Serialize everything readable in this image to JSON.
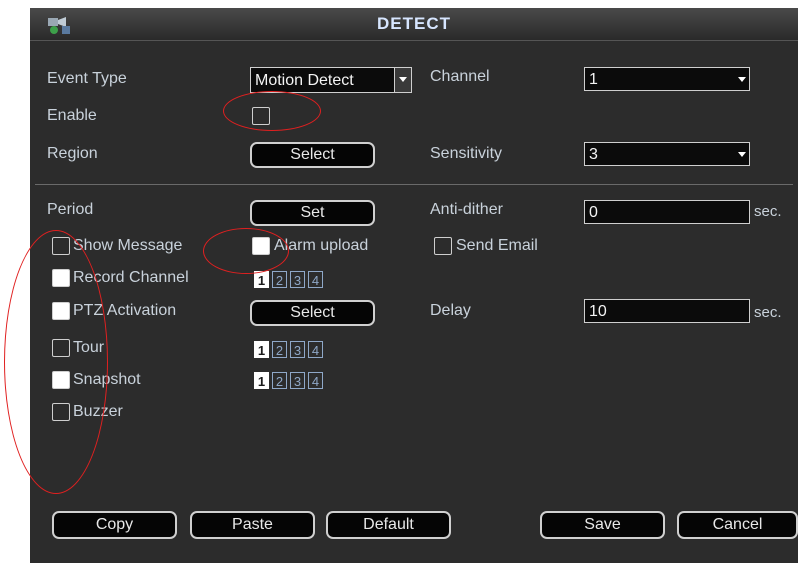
{
  "window": {
    "title": "DETECT"
  },
  "event_type": {
    "label": "Event Type",
    "value": "Motion Detect"
  },
  "channel": {
    "label": "Channel",
    "value": "1"
  },
  "enable": {
    "label": "Enable",
    "checked": false
  },
  "region": {
    "label": "Region",
    "button": "Select"
  },
  "sensitivity": {
    "label": "Sensitivity",
    "value": "3"
  },
  "period": {
    "label": "Period",
    "button": "Set"
  },
  "anti_dither": {
    "label": "Anti-dither",
    "value": "0",
    "unit": "sec."
  },
  "show_message": {
    "label": "Show Message",
    "checked": false
  },
  "alarm_upload": {
    "label": "Alarm upload",
    "checked": true
  },
  "send_email": {
    "label": "Send Email",
    "checked": false
  },
  "record_channel": {
    "label": "Record Channel",
    "checked": true,
    "channels": [
      "1",
      "2",
      "3",
      "4"
    ],
    "selected": [
      "1"
    ]
  },
  "ptz_activation": {
    "label": "PTZ Activation",
    "checked": true,
    "button": "Select"
  },
  "delay": {
    "label": "Delay",
    "value": "10",
    "unit": "sec."
  },
  "tour": {
    "label": "Tour",
    "checked": false,
    "channels": [
      "1",
      "2",
      "3",
      "4"
    ],
    "selected": [
      "1"
    ]
  },
  "snapshot": {
    "label": "Snapshot",
    "checked": true,
    "channels": [
      "1",
      "2",
      "3",
      "4"
    ],
    "selected": [
      "1"
    ]
  },
  "buzzer": {
    "label": "Buzzer",
    "checked": false
  },
  "footer": {
    "copy": "Copy",
    "paste": "Paste",
    "default": "Default",
    "save": "Save",
    "cancel": "Cancel"
  },
  "annotation_color": "#e02020"
}
